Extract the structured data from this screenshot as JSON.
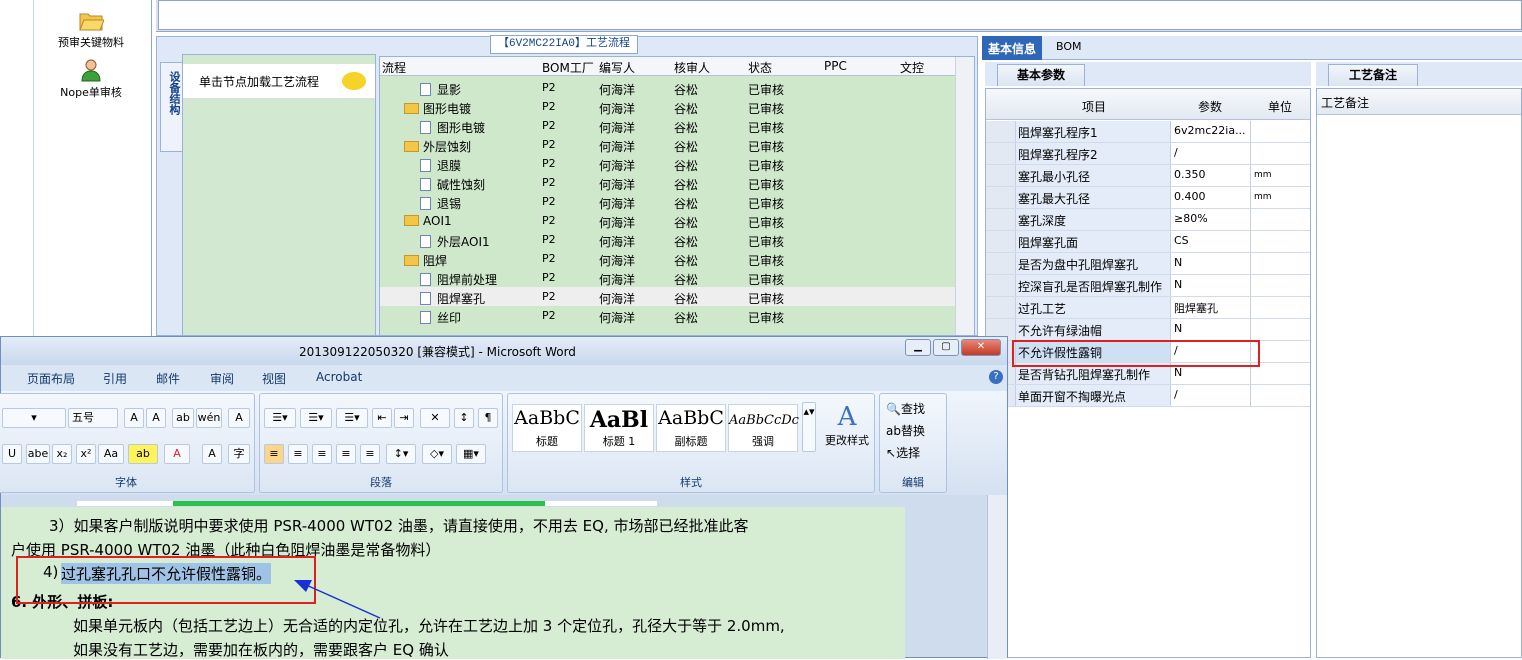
{
  "launcher": {
    "items": [
      {
        "label": "预审关键物料",
        "icon": "folder-open-icon"
      },
      {
        "label": "Nope单审核",
        "icon": "user-check-icon"
      }
    ]
  },
  "process": {
    "title": "【6V2MC22IA0】工艺流程",
    "side_tab": "设备结构",
    "node_hint": "单击节点加载工艺流程",
    "columns": [
      "流程",
      "BOM工厂",
      "编写人",
      "核审人",
      "状态",
      "PPC",
      "文控"
    ],
    "rows": [
      {
        "name": "显影",
        "type": "doc",
        "level": 2,
        "bom": "P2",
        "writer": "何海洋",
        "reviewer": "谷松",
        "status": "已审核"
      },
      {
        "name": "图形电镀",
        "type": "folder",
        "level": 1,
        "bom": "P2",
        "writer": "何海洋",
        "reviewer": "谷松",
        "status": "已审核"
      },
      {
        "name": "图形电镀",
        "type": "doc",
        "level": 2,
        "bom": "P2",
        "writer": "何海洋",
        "reviewer": "谷松",
        "status": "已审核"
      },
      {
        "name": "外层蚀刻",
        "type": "folder",
        "level": 1,
        "bom": "P2",
        "writer": "何海洋",
        "reviewer": "谷松",
        "status": "已审核"
      },
      {
        "name": "退膜",
        "type": "doc",
        "level": 2,
        "bom": "P2",
        "writer": "何海洋",
        "reviewer": "谷松",
        "status": "已审核"
      },
      {
        "name": "碱性蚀刻",
        "type": "doc",
        "level": 2,
        "bom": "P2",
        "writer": "何海洋",
        "reviewer": "谷松",
        "status": "已审核"
      },
      {
        "name": "退锡",
        "type": "doc",
        "level": 2,
        "bom": "P2",
        "writer": "何海洋",
        "reviewer": "谷松",
        "status": "已审核"
      },
      {
        "name": "AOI1",
        "type": "folder",
        "level": 1,
        "bom": "P2",
        "writer": "何海洋",
        "reviewer": "谷松",
        "status": "已审核"
      },
      {
        "name": "外层AOI1",
        "type": "doc",
        "level": 2,
        "bom": "P2",
        "writer": "何海洋",
        "reviewer": "谷松",
        "status": "已审核"
      },
      {
        "name": "阻焊",
        "type": "folder",
        "level": 1,
        "bom": "P2",
        "writer": "何海洋",
        "reviewer": "谷松",
        "status": "已审核"
      },
      {
        "name": "阻焊前处理",
        "type": "doc",
        "level": 2,
        "bom": "P2",
        "writer": "何海洋",
        "reviewer": "谷松",
        "status": "已审核"
      },
      {
        "name": "阻焊塞孔",
        "type": "doc",
        "level": 2,
        "bom": "P2",
        "writer": "何海洋",
        "reviewer": "谷松",
        "status": "已审核",
        "selected": true
      },
      {
        "name": "丝印",
        "type": "doc",
        "level": 2,
        "bom": "P2",
        "writer": "何海洋",
        "reviewer": "谷松",
        "status": "已审核"
      }
    ]
  },
  "info": {
    "tabs": [
      "基本信息",
      "BOM"
    ],
    "sub_tab": "基本参数",
    "notes_tab": "工艺备注",
    "notes_header": "工艺备注",
    "columns": [
      "项目",
      "参数",
      "单位"
    ],
    "rows": [
      {
        "key": "阻焊塞孔程序1",
        "value": "6v2mc22ia...",
        "unit": ""
      },
      {
        "key": "阻焊塞孔程序2",
        "value": "/",
        "unit": ""
      },
      {
        "key": "塞孔最小孔径",
        "value": "0.350",
        "unit": "mm"
      },
      {
        "key": "塞孔最大孔径",
        "value": "0.400",
        "unit": "mm"
      },
      {
        "key": "塞孔深度",
        "value": "≥80%",
        "unit": ""
      },
      {
        "key": "阻焊塞孔面",
        "value": "CS",
        "unit": ""
      },
      {
        "key": "是否为盘中孔阻焊塞孔",
        "value": "N",
        "unit": ""
      },
      {
        "key": "控深盲孔是否阻焊塞孔制作",
        "value": "N",
        "unit": ""
      },
      {
        "key": "过孔工艺",
        "value": "阻焊塞孔",
        "unit": ""
      },
      {
        "key": "不允许有绿油帽",
        "value": "N",
        "unit": ""
      },
      {
        "key": "不允许假性露铜",
        "value": "/",
        "unit": "",
        "highlight": true
      },
      {
        "key": "是否背钻孔阻焊塞孔制作",
        "value": "N",
        "unit": ""
      },
      {
        "key": "单面开窗不掏曝光点",
        "value": "/",
        "unit": ""
      }
    ]
  },
  "word": {
    "title": "201309122050320 [兼容模式] - Microsoft Word",
    "menus": [
      "页面布局",
      "引用",
      "邮件",
      "审阅",
      "视图",
      "Acrobat"
    ],
    "font_size": "五号",
    "groups": {
      "font": "字体",
      "paragraph": "段落",
      "styles": "样式",
      "edit": "编辑"
    },
    "styles": [
      {
        "sample": "AaBbC",
        "name": "标题"
      },
      {
        "sample": "AaBl",
        "name": "标题 1"
      },
      {
        "sample": "AaBbC",
        "name": "副标题"
      },
      {
        "sample": "AaBbCcDc",
        "name": "强调"
      }
    ],
    "change_styles": "更改样式",
    "edit_items": [
      "查找",
      "替换",
      "选择"
    ],
    "doc_lines": [
      "3）如果客户制版说明中要求使用 PSR-4000 WT02 油墨，请直接使用，不用去 EQ, 市场部已经批准此客",
      "户使用 PSR-4000 WT02 油墨（此种白色阻焊油墨是常备物料）",
      "4)",
      "过孔塞孔孔口不允许假性露铜。",
      "6.   外形、拼板:",
      "如果单元板内（包括工艺边上）无合适的内定位孔，允许在工艺边上加 3 个定位孔，孔径大于等于 2.0mm,",
      "如果没有工艺边，需要加在板内的，需要跟客户 EQ 确认"
    ]
  },
  "colors": {
    "highlight_red": "#e02020",
    "grid_green": "#cfe8cc",
    "selection_blue": "#9fc3e6"
  }
}
